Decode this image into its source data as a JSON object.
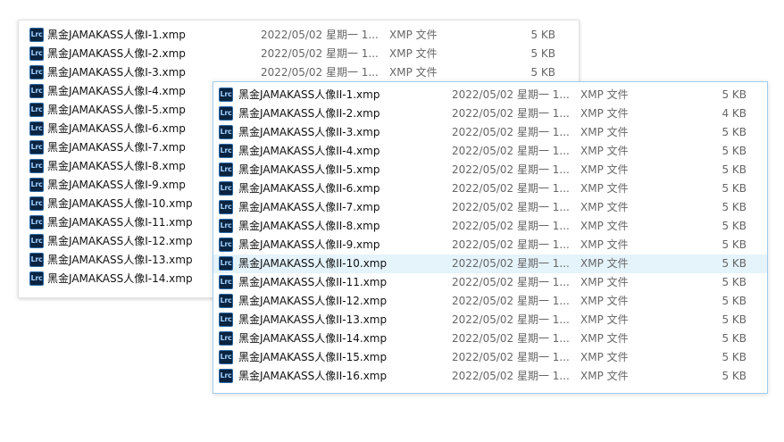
{
  "back_window": {
    "files": [
      {
        "name": "黑金JAMAKASS人像I-1.xmp",
        "date": "2022/05/02 星期一 1...",
        "type": "XMP 文件",
        "size": "5 KB"
      },
      {
        "name": "黑金JAMAKASS人像I-2.xmp",
        "date": "2022/05/02 星期一 1...",
        "type": "XMP 文件",
        "size": "5 KB"
      },
      {
        "name": "黑金JAMAKASS人像I-3.xmp",
        "date": "2022/05/02 星期一 1...",
        "type": "XMP 文件",
        "size": "5 KB"
      },
      {
        "name": "黑金JAMAKASS人像I-4.xmp"
      },
      {
        "name": "黑金JAMAKASS人像I-5.xmp"
      },
      {
        "name": "黑金JAMAKASS人像I-6.xmp"
      },
      {
        "name": "黑金JAMAKASS人像I-7.xmp"
      },
      {
        "name": "黑金JAMAKASS人像I-8.xmp"
      },
      {
        "name": "黑金JAMAKASS人像I-9.xmp"
      },
      {
        "name": "黑金JAMAKASS人像I-10.xmp"
      },
      {
        "name": "黑金JAMAKASS人像I-11.xmp"
      },
      {
        "name": "黑金JAMAKASS人像I-12.xmp"
      },
      {
        "name": "黑金JAMAKASS人像I-13.xmp"
      },
      {
        "name": "黑金JAMAKASS人像I-14.xmp"
      }
    ]
  },
  "front_window": {
    "files": [
      {
        "name": "黑金JAMAKASS人像II-1.xmp",
        "date": "2022/05/02 星期一 1...",
        "type": "XMP 文件",
        "size": "5 KB"
      },
      {
        "name": "黑金JAMAKASS人像II-2.xmp",
        "date": "2022/05/02 星期一 1...",
        "type": "XMP 文件",
        "size": "4 KB"
      },
      {
        "name": "黑金JAMAKASS人像II-3.xmp",
        "date": "2022/05/02 星期一 1...",
        "type": "XMP 文件",
        "size": "5 KB"
      },
      {
        "name": "黑金JAMAKASS人像II-4.xmp",
        "date": "2022/05/02 星期一 1...",
        "type": "XMP 文件",
        "size": "5 KB"
      },
      {
        "name": "黑金JAMAKASS人像II-5.xmp",
        "date": "2022/05/02 星期一 1...",
        "type": "XMP 文件",
        "size": "5 KB"
      },
      {
        "name": "黑金JAMAKASS人像II-6.xmp",
        "date": "2022/05/02 星期一 1...",
        "type": "XMP 文件",
        "size": "5 KB"
      },
      {
        "name": "黑金JAMAKASS人像II-7.xmp",
        "date": "2022/05/02 星期一 1...",
        "type": "XMP 文件",
        "size": "5 KB"
      },
      {
        "name": "黑金JAMAKASS人像II-8.xmp",
        "date": "2022/05/02 星期一 1...",
        "type": "XMP 文件",
        "size": "5 KB"
      },
      {
        "name": "黑金JAMAKASS人像II-9.xmp",
        "date": "2022/05/02 星期一 1...",
        "type": "XMP 文件",
        "size": "5 KB"
      },
      {
        "name": "黑金JAMAKASS人像II-10.xmp",
        "date": "2022/05/02 星期一 1...",
        "type": "XMP 文件",
        "size": "5 KB",
        "selected": true
      },
      {
        "name": "黑金JAMAKASS人像II-11.xmp",
        "date": "2022/05/02 星期一 1...",
        "type": "XMP 文件",
        "size": "5 KB"
      },
      {
        "name": "黑金JAMAKASS人像II-12.xmp",
        "date": "2022/05/02 星期一 1...",
        "type": "XMP 文件",
        "size": "5 KB"
      },
      {
        "name": "黑金JAMAKASS人像II-13.xmp",
        "date": "2022/05/02 星期一 1...",
        "type": "XMP 文件",
        "size": "5 KB"
      },
      {
        "name": "黑金JAMAKASS人像II-14.xmp",
        "date": "2022/05/02 星期一 1...",
        "type": "XMP 文件",
        "size": "5 KB"
      },
      {
        "name": "黑金JAMAKASS人像II-15.xmp",
        "date": "2022/05/02 星期一 1...",
        "type": "XMP 文件",
        "size": "5 KB"
      },
      {
        "name": "黑金JAMAKASS人像II-16.xmp",
        "date": "2022/05/02 星期一 1...",
        "type": "XMP 文件",
        "size": "5 KB"
      }
    ]
  },
  "file_icon": {
    "name": "lightroom-classic-file-icon",
    "label": "Lrc"
  },
  "colors": {
    "selection": "#e5f3fb",
    "front_border": "#9fcdf0",
    "icon_bg": "#0b2440",
    "icon_text": "#9fd0ff"
  }
}
